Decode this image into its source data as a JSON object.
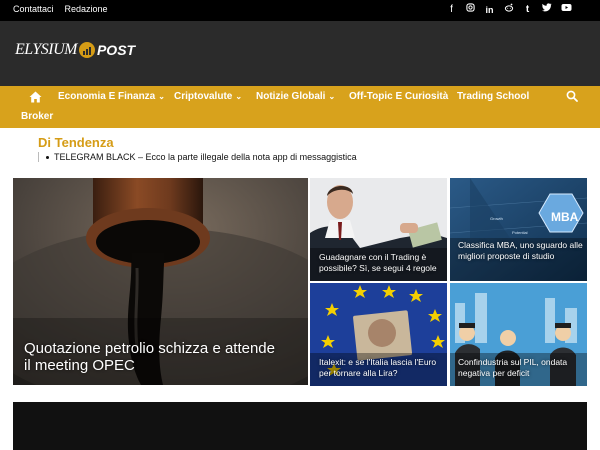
{
  "topbar": {
    "links": [
      "Contattaci",
      "Redazione"
    ],
    "social_icons": [
      "facebook-icon",
      "instagram-icon",
      "linkedin-icon",
      "reddit-icon",
      "tumblr-icon",
      "twitter-icon",
      "youtube-icon"
    ]
  },
  "logo": {
    "word1": "ELYSIUM",
    "word2": "POST"
  },
  "nav": {
    "items": [
      {
        "label": "Economia E Finanza",
        "has_dropdown": true
      },
      {
        "label": "Criptovalute",
        "has_dropdown": true
      },
      {
        "label": "Notizie Globali",
        "has_dropdown": true
      },
      {
        "label": "Off-Topic E Curiosità",
        "has_dropdown": false
      },
      {
        "label": "Trading School",
        "has_dropdown": false
      },
      {
        "label": "Broker",
        "has_dropdown": false
      }
    ],
    "chevron": "⌄"
  },
  "trending": {
    "title": "Di Tendenza",
    "item": "TELEGRAM BLACK – Ecco la parte illegale della nota app di messaggistica"
  },
  "tiles": {
    "main": "Quotazione petrolio schizza e attende il meeting OPEC",
    "t1": "Guadagnare con il Trading è possibile? Sì, se segui 4 regole",
    "t2": "Classifica MBA, uno sguardo alle migliori proposte di studio",
    "t3": "Italexit: e se l'Italia lascia l'Euro per tornare alla Lira?",
    "t4": "Confindustria sul PIL, ondata negativa per deficit",
    "mba_label": "MBA",
    "mba_words": [
      "Potential",
      "Growth"
    ]
  },
  "colors": {
    "accent": "#d8a21c",
    "header": "#2b2b2b",
    "topbar": "#000000"
  }
}
